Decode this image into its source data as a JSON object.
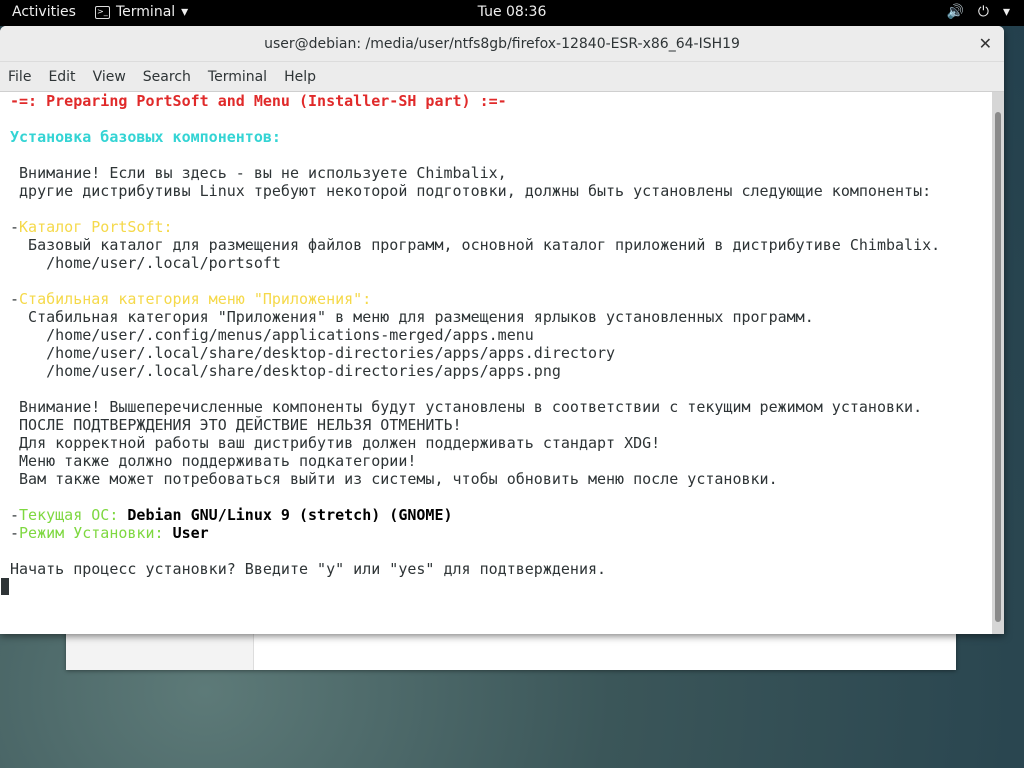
{
  "topbar": {
    "activities": "Activities",
    "app": "Terminal",
    "clock": "Tue 08:36",
    "volume_icon": "🔊",
    "power_icon": "⏻",
    "menu_arrow": "▾",
    "app_arrow": "▾"
  },
  "window": {
    "title": "user@debian: /media/user/ntfs8gb/firefox-12840-ESR-x86_64-ISH19",
    "close": "✕"
  },
  "menu": [
    "File",
    "Edit",
    "View",
    "Search",
    "Terminal",
    "Help"
  ],
  "terminal": {
    "lines": [
      [
        {
          "c": "red",
          "t": "-=: Preparing PortSoft and Menu (Installer-SH part) :=-"
        }
      ],
      [],
      [
        {
          "c": "cyan",
          "t": "Установка базовых компонентов:"
        }
      ],
      [],
      [
        {
          "c": "",
          "t": " Внимание! Если вы здесь - вы не используете Chimbalix,"
        }
      ],
      [
        {
          "c": "",
          "t": " другие дистрибутивы Linux требуют некоторой подготовки, должны быть установлены следующие компоненты:"
        }
      ],
      [],
      [
        {
          "c": "",
          "t": "-"
        },
        {
          "c": "yellow",
          "t": "Каталог PortSoft:"
        }
      ],
      [
        {
          "c": "",
          "t": "  Базовый каталог для размещения файлов программ, основной каталог приложений в дистрибутиве Chimbalix."
        }
      ],
      [
        {
          "c": "",
          "t": "    /home/user/.local/portsoft"
        }
      ],
      [],
      [
        {
          "c": "",
          "t": "-"
        },
        {
          "c": "yellow",
          "t": "Стабильная категория меню \"Приложения\":"
        }
      ],
      [
        {
          "c": "",
          "t": "  Стабильная категория \"Приложения\" в меню для размещения ярлыков установленных программ."
        }
      ],
      [
        {
          "c": "",
          "t": "    /home/user/.config/menus/applications-merged/apps.menu"
        }
      ],
      [
        {
          "c": "",
          "t": "    /home/user/.local/share/desktop-directories/apps/apps.directory"
        }
      ],
      [
        {
          "c": "",
          "t": "    /home/user/.local/share/desktop-directories/apps/apps.png"
        }
      ],
      [],
      [
        {
          "c": "",
          "t": " Внимание! Вышеперечисленные компоненты будут установлены в соответствии с текущим режимом установки."
        }
      ],
      [
        {
          "c": "",
          "t": " ПОСЛЕ ПОДТВЕРЖДЕНИЯ ЭТО ДЕЙСТВИЕ НЕЛЬЗЯ ОТМЕНИТЬ!"
        }
      ],
      [
        {
          "c": "",
          "t": " Для корректной работы ваш дистрибутив должен поддерживать стандарт XDG!"
        }
      ],
      [
        {
          "c": "",
          "t": " Меню также должно поддерживать подкатегории!"
        }
      ],
      [
        {
          "c": "",
          "t": " Вам также может потребоваться выйти из системы, чтобы обновить меню после установки."
        }
      ],
      [],
      [
        {
          "c": "",
          "t": "-"
        },
        {
          "c": "green",
          "t": "Текущая ОС: "
        },
        {
          "c": "bold",
          "t": "Debian GNU/Linux 9 (stretch) (GNOME)"
        }
      ],
      [
        {
          "c": "",
          "t": "-"
        },
        {
          "c": "green",
          "t": "Режим Установки: "
        },
        {
          "c": "bold",
          "t": "User"
        }
      ],
      [],
      [
        {
          "c": "",
          "t": "Начать процесс установки? Введите \"y\" или \"yes\" для подтверждения."
        }
      ]
    ]
  }
}
